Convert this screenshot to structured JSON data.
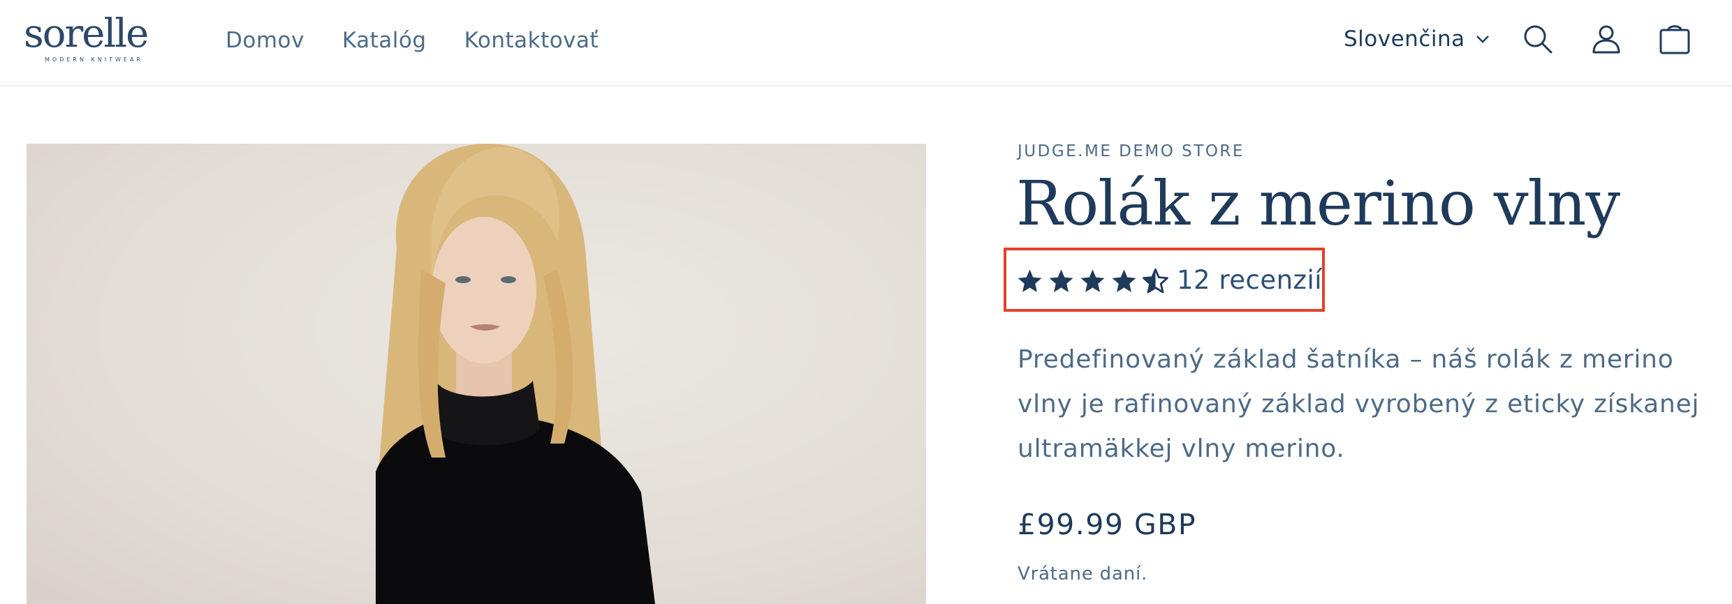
{
  "header": {
    "logo": {
      "word": "sorelle",
      "tagline": "MODERN KNITWEAR"
    },
    "nav": [
      "Domov",
      "Katalóg",
      "Kontaktovať"
    ],
    "language": "Slovenčina",
    "icons": [
      "search-icon",
      "account-icon",
      "cart-icon"
    ]
  },
  "product": {
    "vendor": "JUDGE.ME DEMO STORE",
    "title": "Rolák z merino vlny",
    "rating": {
      "stars": 4.5,
      "max": 5,
      "count_label": "12 recenzií"
    },
    "description": "Predefinovaný základ šatníka – náš rolák z merino vlny je rafinovaný základ vyrobený z eticky získanej ultramäkkej vlny merino.",
    "price": "£99.99 GBP",
    "tax_note": "Vrátane daní."
  },
  "colors": {
    "primary": "#1f3a5a",
    "secondary": "#4d6a86",
    "highlight": "#e0432b"
  }
}
